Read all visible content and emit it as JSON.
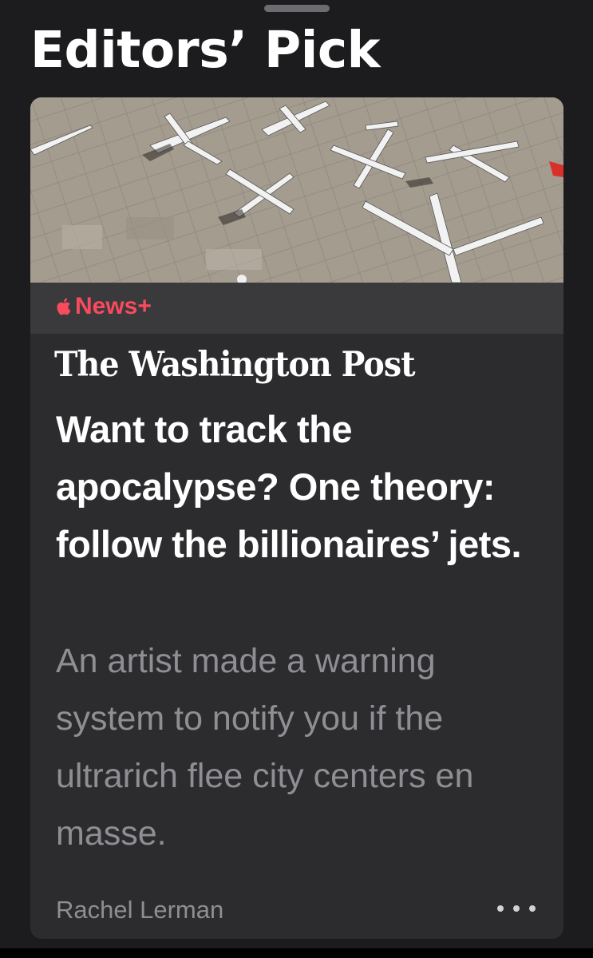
{
  "section": {
    "title": "Editors’ Pick"
  },
  "card": {
    "hero_image": {
      "description_icon": "parked-private-jets-photo"
    },
    "badge": {
      "label": "News+",
      "icon": "apple-logo-icon",
      "color": "#fa4a5e"
    },
    "publisher": "The Washington Post",
    "headline": "Want to track the apocalypse? One theory: follow the billionaires’ jets.",
    "summary": "An artist made a warning system to notify you if the ultrarich flee city centers en masse.",
    "author": "Rachel Lerman",
    "more_icon": "ellipsis-icon"
  },
  "colors": {
    "background": "#1c1c1e",
    "card": "#2c2c2e",
    "badge_bar": "#3a3a3c",
    "secondary_text": "#8e8e93"
  }
}
